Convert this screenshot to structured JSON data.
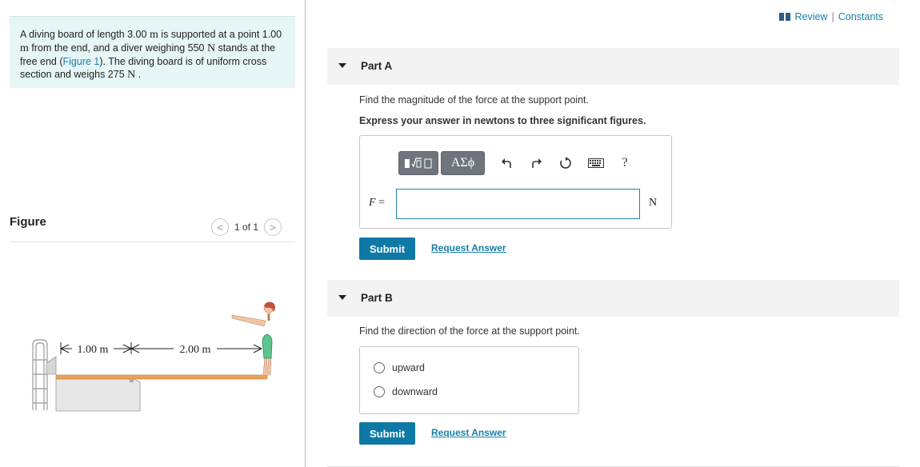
{
  "problem": {
    "text_1": "A diving board of length 3.00 ",
    "unit_m_1": "m",
    "text_2": " is supported at a point 1.00 ",
    "unit_m_2": "m",
    "text_3": " from the end, and a diver weighing 550 ",
    "unit_N_1": "N",
    "text_4": " stands at the free end (",
    "figure_link": "Figure 1",
    "text_5": "). The diving board is of uniform cross section and weighs 275 ",
    "unit_N_2": "N",
    "text_6": " ."
  },
  "figure": {
    "title": "Figure",
    "pager_text": "1 of 1",
    "prev_symbol": "<",
    "next_symbol": ">",
    "dim_left": "1.00 m",
    "dim_right": "2.00 m"
  },
  "header": {
    "review_label": "Review",
    "separator": "|",
    "constants_label": "Constants"
  },
  "part_a": {
    "title": "Part A",
    "question": "Find the magnitude of the force at the support point.",
    "instruction": "Express your answer in newtons to three significant figures.",
    "greek_label": "ΑΣϕ",
    "help_label": "?",
    "variable": "F",
    "equals": " =",
    "input_value": "",
    "unit": "N",
    "submit_label": "Submit",
    "request_label": "Request Answer"
  },
  "part_b": {
    "title": "Part B",
    "question": "Find the direction of the force at the support point.",
    "options": [
      "upward",
      "downward"
    ],
    "submit_label": "Submit",
    "request_label": "Request Answer"
  },
  "colors": {
    "accent": "#0f79a6",
    "link": "#1a7fa8",
    "problem_bg": "#e6f5f6",
    "part_header_bg": "#f3f3f3",
    "board": "#e8a35a"
  },
  "icons": [
    "book-icon",
    "templates-icon",
    "undo-icon",
    "redo-icon",
    "reset-icon",
    "keyboard-icon",
    "help-icon",
    "chevron-left-icon",
    "chevron-right-icon"
  ]
}
